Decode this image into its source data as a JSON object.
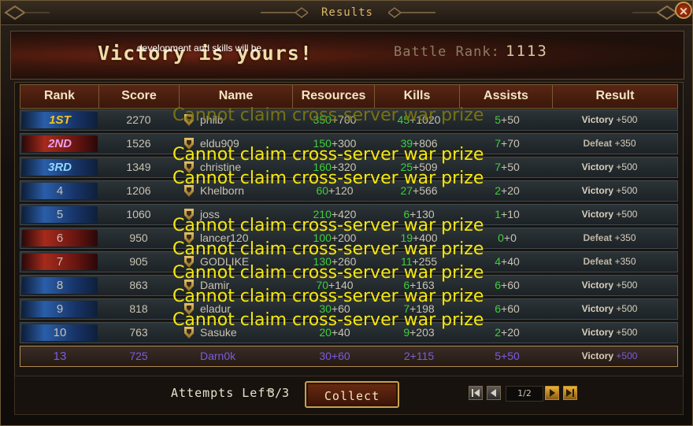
{
  "window": {
    "title": "Results",
    "close_symbol": "×"
  },
  "banner": {
    "headline": "Victory is yours!",
    "tip": "development and skills will be.",
    "battle_rank_label": "Battle Rank:",
    "battle_rank_value": "1113"
  },
  "table": {
    "columns": [
      "Rank",
      "Score",
      "Name",
      "Resources",
      "Kills",
      "Assists",
      "Result"
    ],
    "rows": [
      {
        "rank": "1ST",
        "score": "2270",
        "name": "philb",
        "res_base": "350",
        "res_bonus": "+700",
        "kills_base": "45",
        "kills_bonus": "+1020",
        "ast_base": "5",
        "ast_bonus": "+50",
        "result": "Victory",
        "result_bonus": "+500",
        "ribbon": "blue",
        "rank_color": "#f7c41e"
      },
      {
        "rank": "2ND",
        "score": "1526",
        "name": "eldu909",
        "res_base": "150",
        "res_bonus": "+300",
        "kills_base": "39",
        "kills_bonus": "+806",
        "ast_base": "7",
        "ast_bonus": "+70",
        "result": "Defeat",
        "result_bonus": "+350",
        "ribbon": "red",
        "rank_color": "#e8a0f0"
      },
      {
        "rank": "3RD",
        "score": "1349",
        "name": "christine",
        "res_base": "160",
        "res_bonus": "+320",
        "kills_base": "25",
        "kills_bonus": "+509",
        "ast_base": "7",
        "ast_bonus": "+50",
        "result": "Victory",
        "result_bonus": "+500",
        "ribbon": "blue",
        "rank_color": "#8fd8ff"
      },
      {
        "rank": "4",
        "score": "1206",
        "name": "Khelborn",
        "res_base": "60",
        "res_bonus": "+120",
        "kills_base": "27",
        "kills_bonus": "+566",
        "ast_base": "2",
        "ast_bonus": "+20",
        "result": "Victory",
        "result_bonus": "+500",
        "ribbon": "blue",
        "rank_color": ""
      },
      {
        "rank": "5",
        "score": "1060",
        "name": "joss",
        "res_base": "210",
        "res_bonus": "+420",
        "kills_base": "6",
        "kills_bonus": "+130",
        "ast_base": "1",
        "ast_bonus": "+10",
        "result": "Victory",
        "result_bonus": "+500",
        "ribbon": "blue",
        "rank_color": ""
      },
      {
        "rank": "6",
        "score": "950",
        "name": "lancer120",
        "res_base": "100",
        "res_bonus": "+200",
        "kills_base": "19",
        "kills_bonus": "+400",
        "ast_base": "0",
        "ast_bonus": "+0",
        "result": "Defeat",
        "result_bonus": "+350",
        "ribbon": "red",
        "rank_color": ""
      },
      {
        "rank": "7",
        "score": "905",
        "name": "GODLIKE",
        "res_base": "130",
        "res_bonus": "+260",
        "kills_base": "11",
        "kills_bonus": "+255",
        "ast_base": "4",
        "ast_bonus": "+40",
        "result": "Defeat",
        "result_bonus": "+350",
        "ribbon": "red",
        "rank_color": ""
      },
      {
        "rank": "8",
        "score": "863",
        "name": "Damir",
        "res_base": "70",
        "res_bonus": "+140",
        "kills_base": "6",
        "kills_bonus": "+163",
        "ast_base": "6",
        "ast_bonus": "+60",
        "result": "Victory",
        "result_bonus": "+500",
        "ribbon": "blue",
        "rank_color": ""
      },
      {
        "rank": "9",
        "score": "818",
        "name": "eladur",
        "res_base": "30",
        "res_bonus": "+60",
        "kills_base": "7",
        "kills_bonus": "+198",
        "ast_base": "6",
        "ast_bonus": "+60",
        "result": "Victory",
        "result_bonus": "+500",
        "ribbon": "blue",
        "rank_color": ""
      },
      {
        "rank": "10",
        "score": "763",
        "name": "Sasuke",
        "res_base": "20",
        "res_bonus": "+40",
        "kills_base": "9",
        "kills_bonus": "+203",
        "ast_base": "2",
        "ast_bonus": "+20",
        "result": "Victory",
        "result_bonus": "+500",
        "ribbon": "blue",
        "rank_color": ""
      }
    ],
    "my_row": {
      "rank": "13",
      "score": "725",
      "name": "Darn0k",
      "res_base": "30",
      "res_bonus": "+60",
      "kills_base": "2",
      "kills_bonus": "+115",
      "ast_base": "5",
      "ast_bonus": "+50",
      "result": "Victory",
      "result_bonus": "+500"
    }
  },
  "system_message": "Cannot claim cross-server war prize",
  "footer": {
    "attempts_label": "Attempts Left",
    "attempts_value": "3/3",
    "collect_label": "Collect",
    "page_indicator": "1/2"
  },
  "colors": {
    "accent_gold": "#d9b86a",
    "message_yellow": "#f4e714",
    "green_value": "#3fcf3f",
    "self_purple": "#7a5ce0"
  }
}
